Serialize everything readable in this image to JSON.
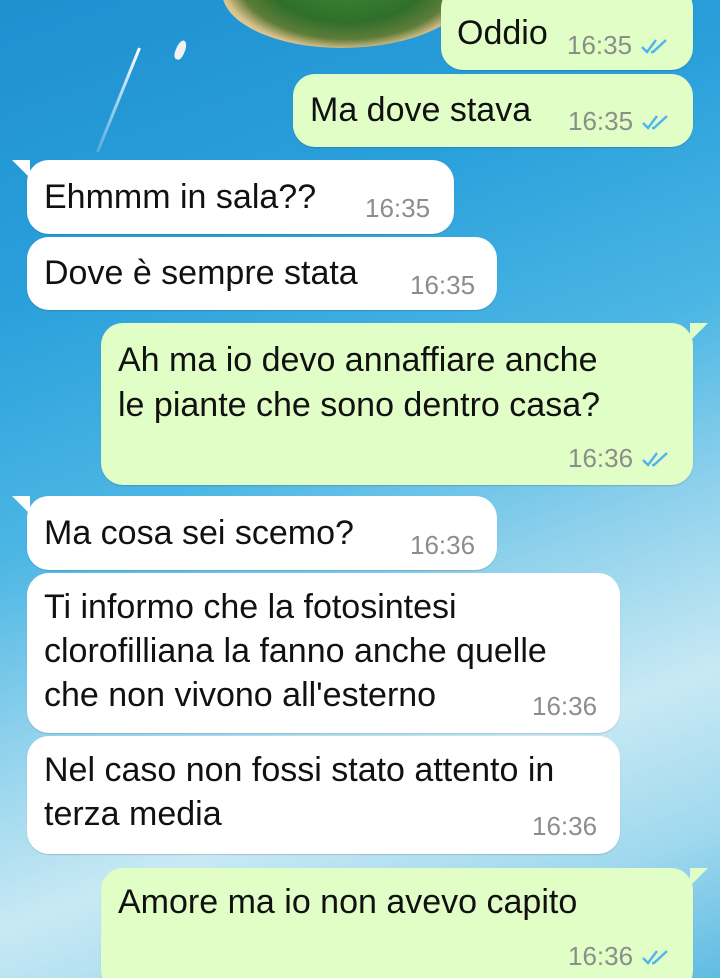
{
  "chat": {
    "messages": [
      {
        "direction": "outgoing",
        "text": "Oddio",
        "time": "16:35",
        "status_icon": "double-check-read-icon"
      },
      {
        "direction": "outgoing",
        "text": "Ma dove stava",
        "time": "16:35",
        "status_icon": "double-check-read-icon"
      },
      {
        "direction": "incoming",
        "text": "Ehmmm in sala??",
        "time": "16:35"
      },
      {
        "direction": "incoming",
        "text": "Dove è sempre stata",
        "time": "16:35"
      },
      {
        "direction": "outgoing",
        "lines": [
          "Ah ma io devo annaffiare anche",
          "le piante che sono dentro casa?"
        ],
        "time": "16:36",
        "status_icon": "double-check-read-icon"
      },
      {
        "direction": "incoming",
        "text": "Ma cosa sei scemo?",
        "time": "16:36"
      },
      {
        "direction": "incoming",
        "lines": [
          "Ti informo che la fotosintesi",
          "clorofilliana la fanno anche quelle",
          "che non vivono all'esterno"
        ],
        "time": "16:36"
      },
      {
        "direction": "incoming",
        "lines": [
          "Nel caso non fossi stato attento in",
          "terza media"
        ],
        "time": "16:36"
      },
      {
        "direction": "outgoing",
        "text": "Amore ma io non avevo capito",
        "time": "16:36",
        "status_icon": "double-check-read-icon"
      }
    ]
  },
  "colors": {
    "outgoing_bubble": "#e1fec6",
    "incoming_bubble": "#ffffff",
    "read_tick": "#4fb3f0",
    "meta_text": "#8a8f8a"
  }
}
